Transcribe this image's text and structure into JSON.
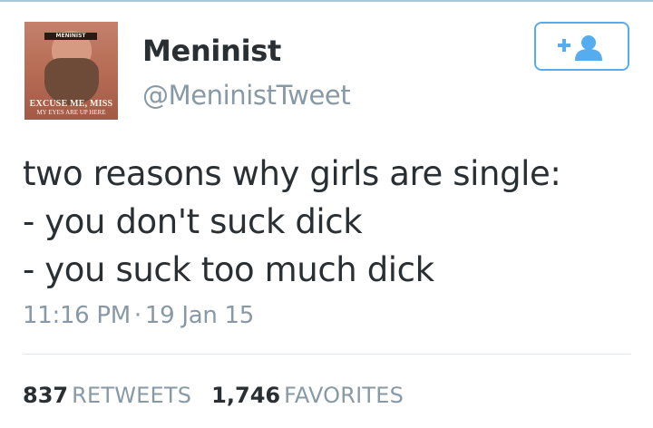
{
  "profile": {
    "display_name": "Meninist",
    "handle": "@MeninistTweet",
    "avatar": {
      "label": "MENINIST",
      "caption_line1": "EXCUSE ME, MISS",
      "caption_line2": "MY EYES ARE UP HERE"
    }
  },
  "follow_button": {
    "icon": "add-user-icon",
    "accent_color": "#55acee"
  },
  "tweet": {
    "lines": [
      "two reasons why girls are single:",
      "- you don't suck dick",
      "- you suck too much dick"
    ],
    "time": "11:16 PM",
    "separator": "·",
    "date": "19 Jan 15"
  },
  "stats": {
    "retweets_count": "837",
    "retweets_label": "RETWEETS",
    "favorites_count": "1,746",
    "favorites_label": "FAVORITES"
  }
}
